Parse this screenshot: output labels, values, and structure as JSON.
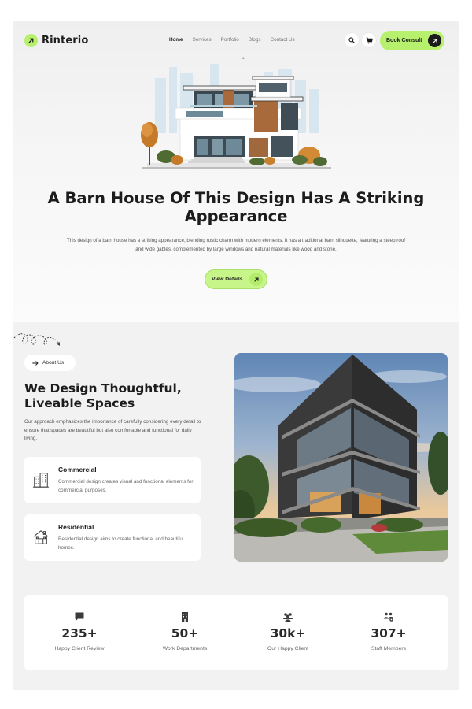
{
  "brand": {
    "name": "Rinterio",
    "accent": "#b6f06c"
  },
  "nav": {
    "items": [
      "Home",
      "Services",
      "Portfolio",
      "Blogs",
      "Contact Us"
    ],
    "active": "Home",
    "search_icon": "search-icon",
    "cart_icon": "cart-icon",
    "cta_label": "Book Consult"
  },
  "hero": {
    "title": "A Barn House Of This Design Has A Striking Appearance",
    "description": "This design of a barn house has a striking appearance, blending rustic charm with modern elements. It has a traditional barn silhouette, featuring a steep roof and wide gables, complemented by large windows and natural materials like wood and stone.",
    "cta_label": "View Details"
  },
  "about": {
    "pill_label": "About Us",
    "title": "We Design Thoughtful, Liveable Spaces",
    "description": "Our approach emphasizes the importance of carefully considering every detail to ensure that spaces are beautiful but also comfortable and functional for daily living.",
    "cards": [
      {
        "title": "Commercial",
        "text": "Commercial design creates visual and functional elements for commercial purposes.",
        "icon": "building-icon"
      },
      {
        "title": "Residential",
        "text": "Residential design aims to create functional and beautiful homes.",
        "icon": "home-icon"
      }
    ]
  },
  "stats": [
    {
      "value": "235+",
      "label": "Happy Client Review",
      "icon": "chat-icon"
    },
    {
      "value": "50+",
      "label": "Work Departments",
      "icon": "office-icon"
    },
    {
      "value": "30k+",
      "label": "Our Happy Client",
      "icon": "users-icon"
    },
    {
      "value": "307+",
      "label": "Staff Members",
      "icon": "team-icon"
    }
  ]
}
